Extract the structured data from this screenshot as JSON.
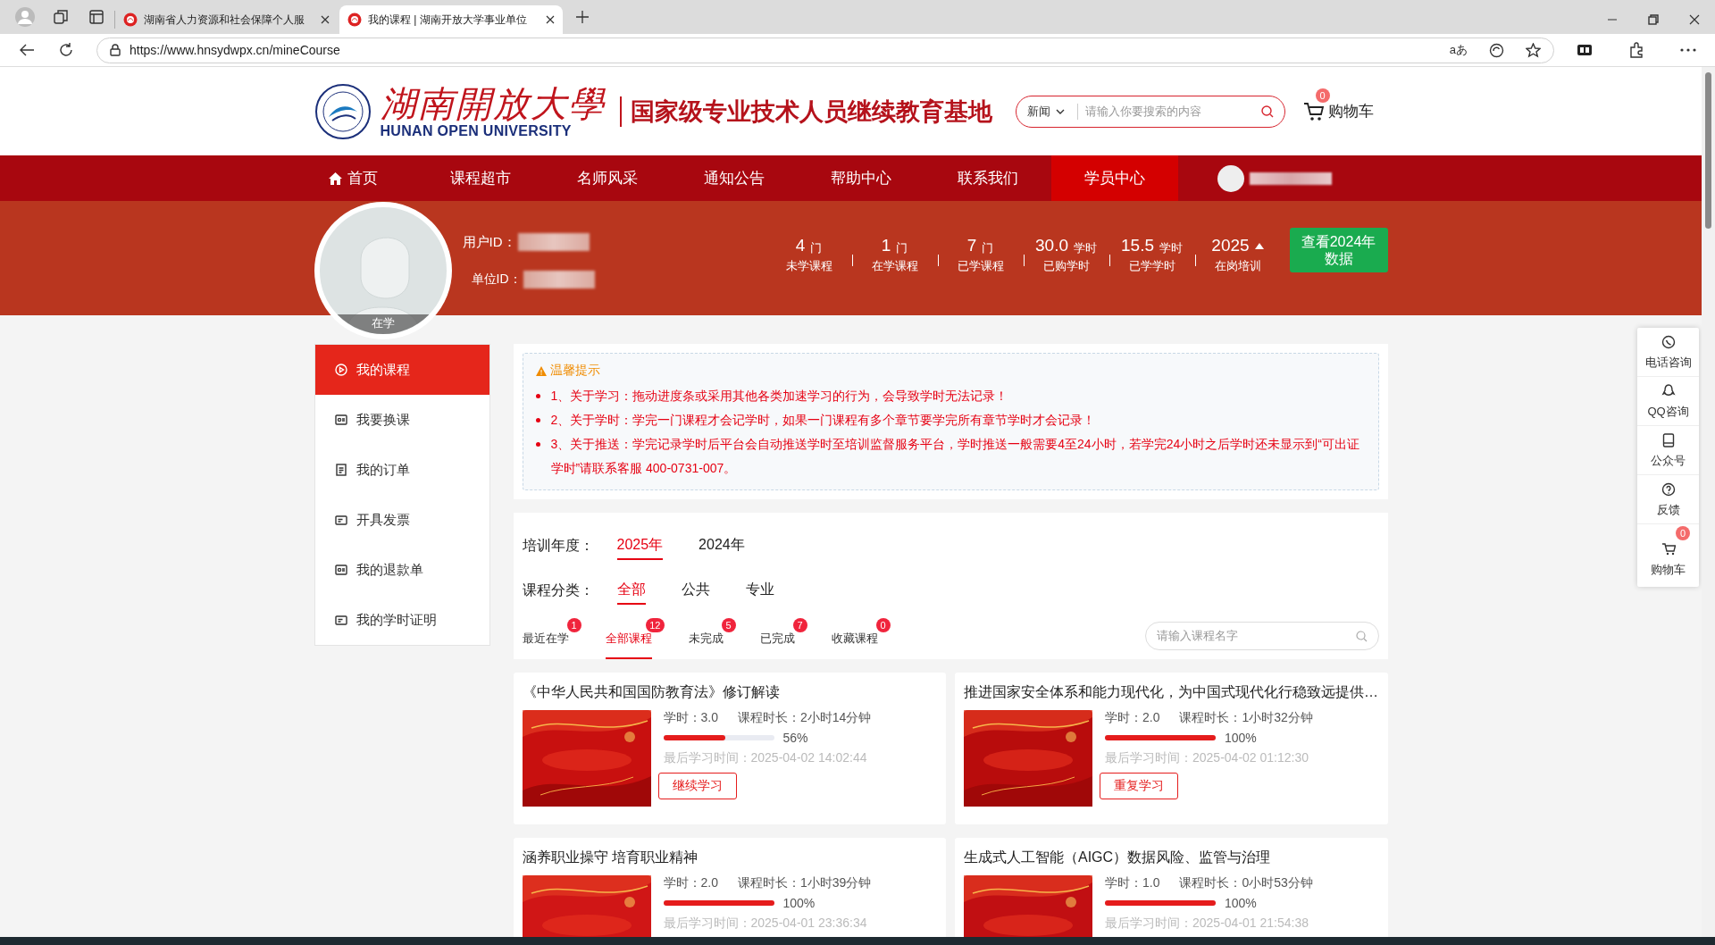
{
  "browser": {
    "tabs": [
      {
        "title": "湖南省人力资源和社会保障个人服",
        "selected": false
      },
      {
        "title": "我的课程 | 湖南开放大学事业单位",
        "selected": true
      }
    ],
    "url": "https://www.hnsydwpx.cn/mineCourse",
    "reader_label": "aあ"
  },
  "header": {
    "logo_cn": "湖南開放大學",
    "logo_en": "HUNAN OPEN UNIVERSITY",
    "slogan": "国家级专业技术人员继续教育基地",
    "search": {
      "category": "新闻",
      "placeholder": "请输入你要搜索的内容"
    },
    "cart": {
      "count": "0",
      "label": "购物车"
    }
  },
  "nav": [
    {
      "label": "首页",
      "kind": "home",
      "selected": false
    },
    {
      "label": "课程超市",
      "kind": "link",
      "selected": false
    },
    {
      "label": "名师风采",
      "kind": "link",
      "selected": false
    },
    {
      "label": "通知公告",
      "kind": "link",
      "selected": false
    },
    {
      "label": "帮助中心",
      "kind": "link",
      "selected": false
    },
    {
      "label": "联系我们",
      "kind": "link",
      "selected": false
    },
    {
      "label": "学员中心",
      "kind": "link",
      "selected": true
    }
  ],
  "profile": {
    "status": "在学",
    "user_id_label": "用户ID：",
    "unit_id_label": "单位ID：",
    "stats": [
      {
        "kind": "count",
        "value": "4",
        "unit": "门",
        "label": "未学课程"
      },
      {
        "kind": "count",
        "value": "1",
        "unit": "门",
        "label": "在学课程"
      },
      {
        "kind": "count",
        "value": "7",
        "unit": "门",
        "label": "已学课程"
      },
      {
        "kind": "count",
        "value": "30.0",
        "unit": "学时",
        "label": "已购学时"
      },
      {
        "kind": "count",
        "value": "15.5",
        "unit": "学时",
        "label": "已学学时"
      },
      {
        "kind": "year",
        "value": "2025",
        "label": "在岗培训"
      }
    ],
    "year_button": "查看2024年数据"
  },
  "sidebar": {
    "items": [
      {
        "label": "我的课程",
        "kind": "play",
        "selected": true
      },
      {
        "label": "我要换课",
        "kind": "card",
        "selected": false
      },
      {
        "label": "我的订单",
        "kind": "doc",
        "selected": false
      },
      {
        "label": "开具发票",
        "kind": "ticket",
        "selected": false
      },
      {
        "label": "我的退款单",
        "kind": "card",
        "selected": false
      },
      {
        "label": "我的学时证明",
        "kind": "ticket",
        "selected": false
      }
    ]
  },
  "notice": {
    "title": "温馨提示",
    "items": [
      "1、关于学习：拖动进度条或采用其他各类加速学习的行为，会导致学时无法记录！",
      "2、关于学时：学完一门课程才会记学时，如果一门课程有多个章节要学完所有章节学时才会记录！",
      "3、关于推送：学完记录学时后平台会自动推送学时至培训监督服务平台，学时推送一般需要4至24小时，若学完24小时之后学时还未显示到“可出证学时”请联系客服 400-0731-007。"
    ]
  },
  "filters": {
    "year_label": "培训年度：",
    "years": [
      {
        "label": "2025年",
        "selected": true
      },
      {
        "label": "2024年",
        "selected": false
      }
    ],
    "category_label": "课程分类：",
    "categories": [
      {
        "label": "全部",
        "selected": true
      },
      {
        "label": "公共",
        "selected": false
      },
      {
        "label": "专业",
        "selected": false
      }
    ],
    "tabs": [
      {
        "label": "最近在学",
        "count": "1",
        "selected": false
      },
      {
        "label": "全部课程",
        "count": "12",
        "selected": true
      },
      {
        "label": "未完成",
        "count": "5",
        "selected": false
      },
      {
        "label": "已完成",
        "count": "7",
        "selected": false
      },
      {
        "label": "收藏课程",
        "count": "0",
        "selected": false
      }
    ],
    "search": {
      "placeholder": "请输入课程名字"
    }
  },
  "courses": [
    {
      "title": "《中华人民共和国国防教育法》修订解读",
      "hours": "学时：3.0",
      "duration": "课程时长：2小时14分钟",
      "level": 0.56,
      "percent": "56%",
      "last_study": "最后学习时间：2025-04-02 14:02:44",
      "button": "继续学习"
    },
    {
      "title": "推进国家安全体系和能力现代化，为中国式现代化行稳致远提供…",
      "hours": "学时：2.0",
      "duration": "课程时长：1小时32分钟",
      "level": 1,
      "percent": "100%",
      "last_study": "最后学习时间：2025-04-02 01:12:30",
      "button": "重复学习"
    },
    {
      "title": "涵养职业操守 培育职业精神",
      "hours": "学时：2.0",
      "duration": "课程时长：1小时39分钟",
      "level": 1,
      "percent": "100%",
      "last_study": "最后学习时间：2025-04-01 23:36:34"
    },
    {
      "title": "生成式人工智能（AIGC）数据风险、监管与治理",
      "hours": "学时：1.0",
      "duration": "课程时长：0小时53分钟",
      "level": 1,
      "percent": "100%",
      "last_study": "最后学习时间：2025-04-01 21:54:38"
    }
  ],
  "float_bar": [
    {
      "label": "电话咨询",
      "kind": "phone"
    },
    {
      "label": "QQ咨询",
      "kind": "qq"
    },
    {
      "label": "公众号",
      "kind": "account"
    },
    {
      "label": "反馈",
      "kind": "help"
    },
    {
      "label": "购物车",
      "kind": "cart",
      "count": "0"
    }
  ]
}
